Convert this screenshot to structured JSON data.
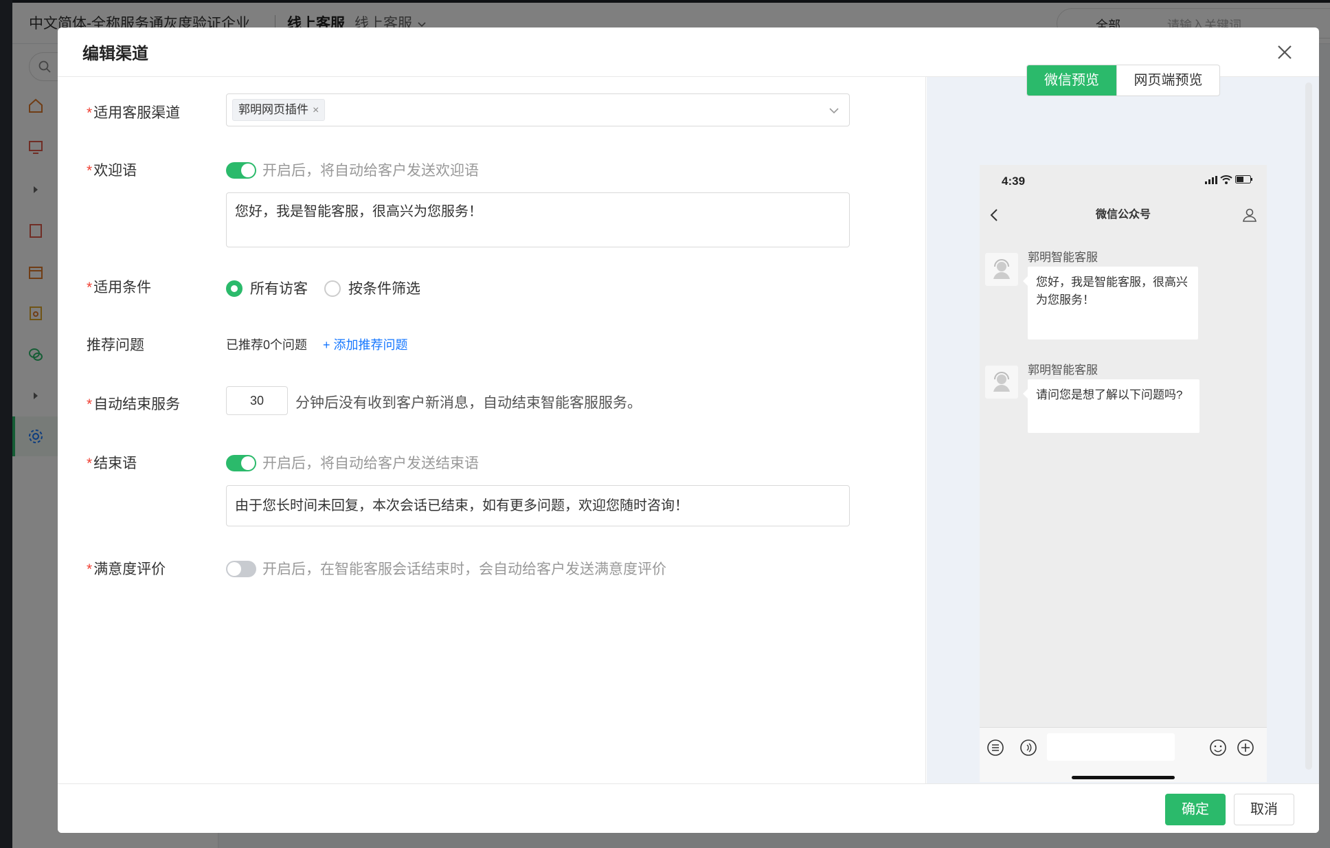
{
  "app": {
    "breadcrumb": "中文简体-全称服务通灰度验证企业",
    "active_tab": "线上客服",
    "dropdown_tab": "线上客服",
    "search": {
      "scope": "全部",
      "placeholder": "请输入关键词"
    }
  },
  "modal": {
    "title": "编辑渠道",
    "fields": {
      "channel": {
        "label": "适用客服渠道",
        "required": true,
        "selected_tag": "郭明网页插件"
      },
      "welcome": {
        "label": "欢迎语",
        "required": true,
        "switch_on": true,
        "hint": "开启后，将自动给客户发送欢迎语",
        "text": "您好，我是智能客服，很高兴为您服务！"
      },
      "conditions": {
        "label": "适用条件",
        "required": true,
        "options": [
          "所有访客",
          "按条件筛选"
        ],
        "selected": "所有访客"
      },
      "recommend": {
        "label": "推荐问题",
        "required": false,
        "count_text": "已推荐0个问题",
        "add_link": "+ 添加推荐问题"
      },
      "auto_end": {
        "label": "自动结束服务",
        "required": true,
        "minutes": "30",
        "suffix": "分钟后没有收到客户新消息，自动结束智能客服服务。"
      },
      "ending": {
        "label": "结束语",
        "required": true,
        "switch_on": true,
        "hint": "开启后，将自动给客户发送结束语",
        "text": "由于您长时间未回复，本次会话已结束，如有更多问题，欢迎您随时咨询！"
      },
      "satisfaction": {
        "label": "满意度评价",
        "required": true,
        "switch_on": false,
        "hint": "开启后，在智能客服会话结束时，会自动给客户发送满意度评价"
      }
    },
    "preview": {
      "toggle": {
        "wechat": "微信预览",
        "web": "网页端预览",
        "active": "wechat"
      },
      "phone": {
        "time": "4:39",
        "nav_title": "微信公众号",
        "messages": [
          {
            "sender": "郭明智能客服",
            "text": "您好，我是智能客服，很高兴为您服务！"
          },
          {
            "sender": "郭明智能客服",
            "text": "请问您是想了解以下问题吗?"
          }
        ]
      }
    },
    "footer": {
      "confirm": "确定",
      "cancel": "取消"
    }
  },
  "colors": {
    "accent": "#2bba6b",
    "link": "#1677ff",
    "required": "#f04134"
  }
}
